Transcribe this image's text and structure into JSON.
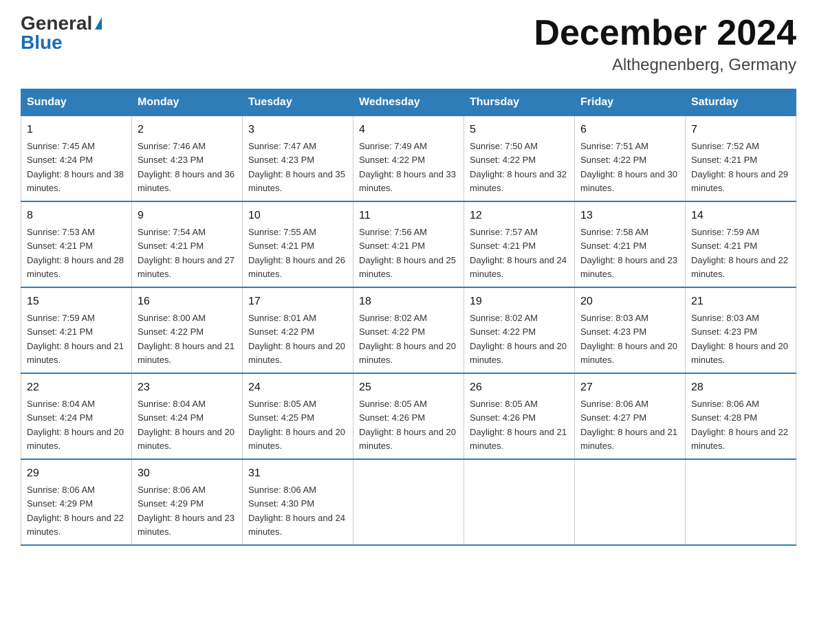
{
  "header": {
    "logo_general": "General",
    "logo_blue": "Blue",
    "month_title": "December 2024",
    "location": "Althegnenberg, Germany"
  },
  "weekdays": [
    "Sunday",
    "Monday",
    "Tuesday",
    "Wednesday",
    "Thursday",
    "Friday",
    "Saturday"
  ],
  "weeks": [
    [
      {
        "day": "1",
        "sunrise": "7:45 AM",
        "sunset": "4:24 PM",
        "daylight": "8 hours and 38 minutes."
      },
      {
        "day": "2",
        "sunrise": "7:46 AM",
        "sunset": "4:23 PM",
        "daylight": "8 hours and 36 minutes."
      },
      {
        "day": "3",
        "sunrise": "7:47 AM",
        "sunset": "4:23 PM",
        "daylight": "8 hours and 35 minutes."
      },
      {
        "day": "4",
        "sunrise": "7:49 AM",
        "sunset": "4:22 PM",
        "daylight": "8 hours and 33 minutes."
      },
      {
        "day": "5",
        "sunrise": "7:50 AM",
        "sunset": "4:22 PM",
        "daylight": "8 hours and 32 minutes."
      },
      {
        "day": "6",
        "sunrise": "7:51 AM",
        "sunset": "4:22 PM",
        "daylight": "8 hours and 30 minutes."
      },
      {
        "day": "7",
        "sunrise": "7:52 AM",
        "sunset": "4:21 PM",
        "daylight": "8 hours and 29 minutes."
      }
    ],
    [
      {
        "day": "8",
        "sunrise": "7:53 AM",
        "sunset": "4:21 PM",
        "daylight": "8 hours and 28 minutes."
      },
      {
        "day": "9",
        "sunrise": "7:54 AM",
        "sunset": "4:21 PM",
        "daylight": "8 hours and 27 minutes."
      },
      {
        "day": "10",
        "sunrise": "7:55 AM",
        "sunset": "4:21 PM",
        "daylight": "8 hours and 26 minutes."
      },
      {
        "day": "11",
        "sunrise": "7:56 AM",
        "sunset": "4:21 PM",
        "daylight": "8 hours and 25 minutes."
      },
      {
        "day": "12",
        "sunrise": "7:57 AM",
        "sunset": "4:21 PM",
        "daylight": "8 hours and 24 minutes."
      },
      {
        "day": "13",
        "sunrise": "7:58 AM",
        "sunset": "4:21 PM",
        "daylight": "8 hours and 23 minutes."
      },
      {
        "day": "14",
        "sunrise": "7:59 AM",
        "sunset": "4:21 PM",
        "daylight": "8 hours and 22 minutes."
      }
    ],
    [
      {
        "day": "15",
        "sunrise": "7:59 AM",
        "sunset": "4:21 PM",
        "daylight": "8 hours and 21 minutes."
      },
      {
        "day": "16",
        "sunrise": "8:00 AM",
        "sunset": "4:22 PM",
        "daylight": "8 hours and 21 minutes."
      },
      {
        "day": "17",
        "sunrise": "8:01 AM",
        "sunset": "4:22 PM",
        "daylight": "8 hours and 20 minutes."
      },
      {
        "day": "18",
        "sunrise": "8:02 AM",
        "sunset": "4:22 PM",
        "daylight": "8 hours and 20 minutes."
      },
      {
        "day": "19",
        "sunrise": "8:02 AM",
        "sunset": "4:22 PM",
        "daylight": "8 hours and 20 minutes."
      },
      {
        "day": "20",
        "sunrise": "8:03 AM",
        "sunset": "4:23 PM",
        "daylight": "8 hours and 20 minutes."
      },
      {
        "day": "21",
        "sunrise": "8:03 AM",
        "sunset": "4:23 PM",
        "daylight": "8 hours and 20 minutes."
      }
    ],
    [
      {
        "day": "22",
        "sunrise": "8:04 AM",
        "sunset": "4:24 PM",
        "daylight": "8 hours and 20 minutes."
      },
      {
        "day": "23",
        "sunrise": "8:04 AM",
        "sunset": "4:24 PM",
        "daylight": "8 hours and 20 minutes."
      },
      {
        "day": "24",
        "sunrise": "8:05 AM",
        "sunset": "4:25 PM",
        "daylight": "8 hours and 20 minutes."
      },
      {
        "day": "25",
        "sunrise": "8:05 AM",
        "sunset": "4:26 PM",
        "daylight": "8 hours and 20 minutes."
      },
      {
        "day": "26",
        "sunrise": "8:05 AM",
        "sunset": "4:26 PM",
        "daylight": "8 hours and 21 minutes."
      },
      {
        "day": "27",
        "sunrise": "8:06 AM",
        "sunset": "4:27 PM",
        "daylight": "8 hours and 21 minutes."
      },
      {
        "day": "28",
        "sunrise": "8:06 AM",
        "sunset": "4:28 PM",
        "daylight": "8 hours and 22 minutes."
      }
    ],
    [
      {
        "day": "29",
        "sunrise": "8:06 AM",
        "sunset": "4:29 PM",
        "daylight": "8 hours and 22 minutes."
      },
      {
        "day": "30",
        "sunrise": "8:06 AM",
        "sunset": "4:29 PM",
        "daylight": "8 hours and 23 minutes."
      },
      {
        "day": "31",
        "sunrise": "8:06 AM",
        "sunset": "4:30 PM",
        "daylight": "8 hours and 24 minutes."
      },
      null,
      null,
      null,
      null
    ]
  ],
  "labels": {
    "sunrise": "Sunrise:",
    "sunset": "Sunset:",
    "daylight": "Daylight:"
  }
}
